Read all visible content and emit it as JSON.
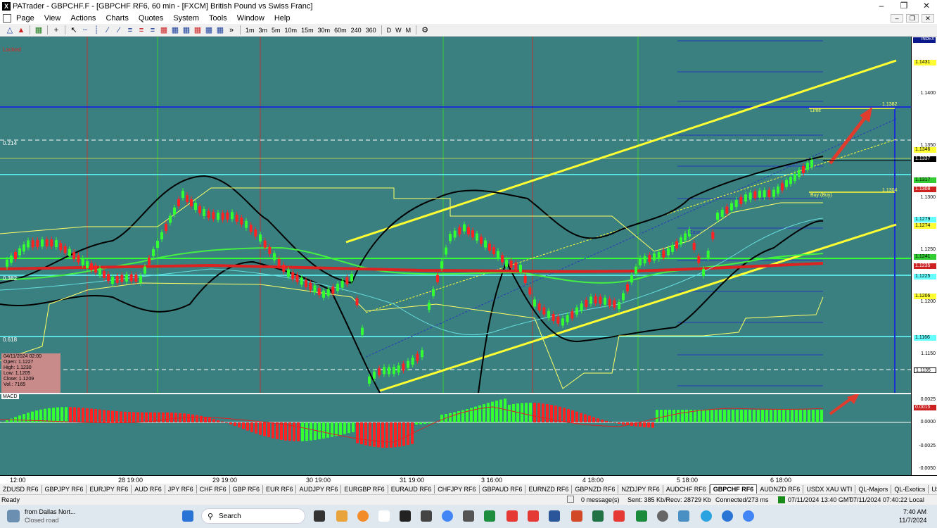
{
  "window": {
    "title": "PATrader - GBPCHF.F - [GBPCHF RF6, 60 min - [FXCM] British Pound vs Swiss Franc]",
    "app_icon": "X"
  },
  "menu": [
    "Page",
    "View",
    "Actions",
    "Charts",
    "Quotes",
    "System",
    "Tools",
    "Window",
    "Help"
  ],
  "toolbar": {
    "timeframes": [
      "1m",
      "3m",
      "5m",
      "10m",
      "15m",
      "30m",
      "60m",
      "240",
      "360"
    ],
    "periods": [
      "D",
      "W",
      "M"
    ]
  },
  "chart": {
    "locked_label": "Locked",
    "fib_labels": [
      "0.214",
      "0.382",
      "0.618"
    ],
    "limit_label": "Limit",
    "limit_price": "1.1382",
    "buy_label": "Buy (Buy)",
    "buy_price": "1.1304",
    "base_label": "Base",
    "info": {
      "date": "04/11/2024 02:00",
      "open": "Open: 1.1227",
      "high": "High: 1.1230",
      "low": "Low: 1.1205",
      "close": "Close: 1.1209",
      "vol": "Vol.: 7165"
    }
  },
  "price_axis": {
    "index_label": "INDEX",
    "ticks": [
      "1.1400",
      "1.1350",
      "1.1300",
      "1.1250",
      "1.1200",
      "1.1150"
    ],
    "boxes": [
      {
        "v": "1.1431",
        "c": "#ffff33"
      },
      {
        "v": "1.1346",
        "c": "#ffff33"
      },
      {
        "v": "1.1337",
        "c": "#000000",
        "t": "#ffffff"
      },
      {
        "v": "1.1317",
        "c": "#33cc33"
      },
      {
        "v": "1.1308",
        "c": "#cc2222",
        "t": "#ffffff"
      },
      {
        "v": "1.1279",
        "c": "#66ffff"
      },
      {
        "v": "1.1274",
        "c": "#ffff33"
      },
      {
        "v": "1.1241",
        "c": "#33cc33"
      },
      {
        "v": "1.1235",
        "c": "#cc2222",
        "t": "#ffffff"
      },
      {
        "v": "1.1225",
        "c": "#66ffff"
      },
      {
        "v": "1.1206",
        "c": "#ffff33"
      },
      {
        "v": "1.1166",
        "c": "#66ffff"
      },
      {
        "v": "1.1135",
        "c": "#ffffff"
      }
    ]
  },
  "macd": {
    "label": "MACD",
    "ticks": [
      "0.0025",
      "0.0000",
      "-0.0025",
      "-0.0050"
    ],
    "value_box": "0.0015"
  },
  "time_axis": [
    "12:00",
    "28 19:00",
    "29 19:00",
    "30 19:00",
    "31 19:00",
    "3 16:00",
    "4 18:00",
    "5 18:00",
    "6 18:00"
  ],
  "symbol_tabs": [
    "ZDUSD RF6",
    "GBPJPY RF6",
    "EURJPY RF6",
    "AUD RF6",
    "JPY RF6",
    "CHF RF6",
    "GBP RF6",
    "EUR RF6",
    "AUDJPY RF6",
    "EURGBP RF6",
    "EURAUD RF6",
    "CHFJPY RF6",
    "GBPAUD RF6",
    "EURNZD RF6",
    "GBPNZD RF6",
    "NZDJPY RF6",
    "AUDCHF RF6",
    "GBPCHF RF6",
    "AUDNZD RF6",
    "USDX XAU WTI",
    "QL-Majors",
    "QL-Exotics",
    "USDX RF6",
    "Bitcoin",
    "SP500 RF6",
    "DJIA",
    "Lyte"
  ],
  "active_tab": "GBPCHF RF6",
  "status": {
    "ready": "Ready",
    "messages": "0 message(s)",
    "traffic": "Sent: 385 Kb/Recv: 28729 Kb",
    "connected": "Connected/273 ms",
    "gmt": "07/11/2024 13:40 GMT",
    "local": "07/11/2024 07:40:22 Local"
  },
  "taskbar": {
    "weather_title": "from Dallas Nort...",
    "weather_sub": "Closed road",
    "search": "Search",
    "time": "7:40 AM",
    "date": "11/7/2024"
  }
}
